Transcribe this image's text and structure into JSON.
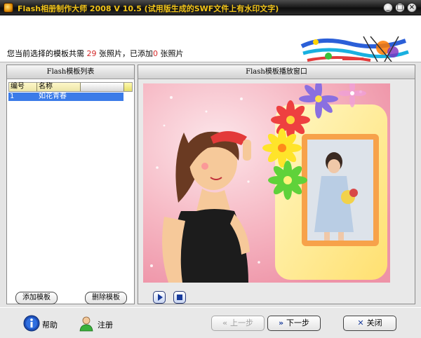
{
  "window": {
    "title": "Flash相册制作大师 2008 V 10.5 (试用版生成的SWF文件上有水印文字)",
    "min_symbol": "_",
    "max_symbol": "□",
    "close_symbol": "×"
  },
  "info": {
    "prefix": "您当前选择的模板共需",
    "required_count": "29",
    "middle": "张照片，已添加",
    "added_count": "0",
    "suffix": "张照片"
  },
  "template_list": {
    "title": "Flash模板列表",
    "columns": [
      "编号",
      "名称"
    ],
    "rows": [
      {
        "number": "1",
        "name": "如花青春"
      }
    ],
    "add_label": "添加模板",
    "delete_label": "删除模板"
  },
  "preview": {
    "title": "Flash模板播放窗口"
  },
  "footer": {
    "help_label": "帮助",
    "register_label": "注册",
    "prev_label": "上一步",
    "next_label": "下一步",
    "close_label": "关闭",
    "prev_icon": "«",
    "next_icon": "»",
    "close_icon": "✕"
  },
  "colors": {
    "accent_title": "#f2c418",
    "count_red": "#d42a2a",
    "selection_blue": "#3b7be8",
    "preview_bg": "#f3a8b6"
  },
  "icons": {
    "help": "info-circle-icon",
    "register": "user-icon",
    "play": "play-icon",
    "stop": "stop-icon"
  }
}
